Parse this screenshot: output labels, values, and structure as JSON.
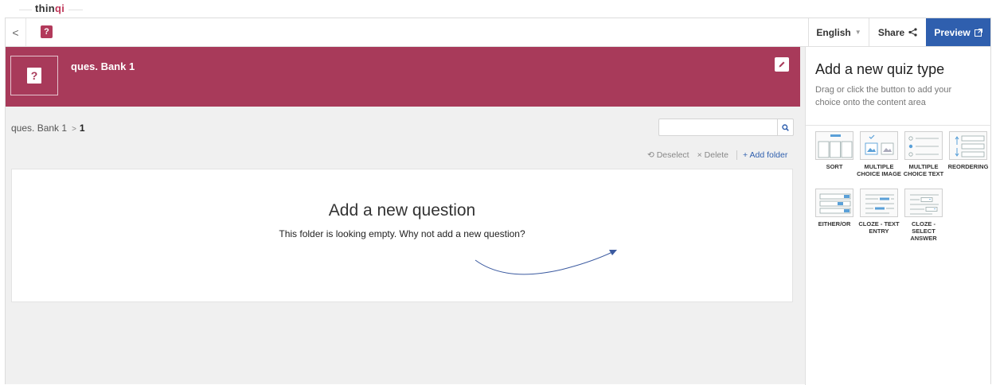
{
  "brand": {
    "logo_prefix": "thin",
    "logo_accent": "qi"
  },
  "topbar": {
    "back_glyph": "<",
    "app_icon_glyph": "?",
    "language": "English",
    "share": "Share",
    "preview": "Preview"
  },
  "banner": {
    "title": "ques. Bank 1",
    "color": "#a83a5a"
  },
  "breadcrumb": {
    "root": "ques. Bank 1",
    "sep": ">",
    "current": "1"
  },
  "search": {
    "placeholder": "",
    "value": ""
  },
  "actions": {
    "deselect": "Deselect",
    "delete": "Delete",
    "add_folder": "+ Add folder"
  },
  "empty_state": {
    "title": "Add a new question",
    "subtitle": "This folder is looking empty. Why not add a new question?"
  },
  "quiz_panel": {
    "title": "Add a new quiz type",
    "description": "Drag or click the button to add your choice onto the content area",
    "types": [
      {
        "label": "SORT",
        "icon": "sort-icon"
      },
      {
        "label": "MULTIPLE CHOICE IMAGE",
        "icon": "multiple-choice-image-icon"
      },
      {
        "label": "MULTIPLE CHOICE TEXT",
        "icon": "multiple-choice-text-icon"
      },
      {
        "label": "REORDERING",
        "icon": "reordering-icon"
      },
      {
        "label": "EITHER/OR",
        "icon": "either-or-icon"
      },
      {
        "label": "CLOZE - TEXT ENTRY",
        "icon": "cloze-text-entry-icon"
      },
      {
        "label": "CLOZE - SELECT ANSWER",
        "icon": "cloze-select-answer-icon"
      }
    ]
  },
  "colors": {
    "accent": "#a83a5a",
    "primary": "#2f5fae",
    "icon_blue": "#5aa0d8"
  }
}
